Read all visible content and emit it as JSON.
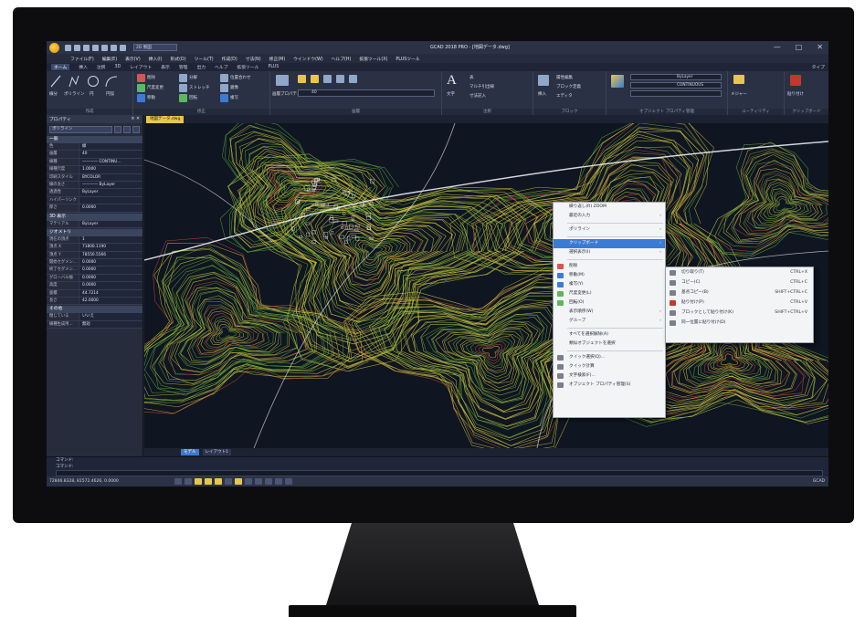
{
  "titlebar": {
    "workspace": "2D 製図",
    "document_title": "GCAD 2018 PRO - [地図データ.dwg]"
  },
  "menu": [
    "ファイル(F)",
    "編集(E)",
    "表示(V)",
    "挿入(I)",
    "形式(O)",
    "ツール(T)",
    "作成(D)",
    "寸法(N)",
    "修正(M)",
    "ウインドウ(W)",
    "ヘルプ(H)",
    "拡張ツール(X)",
    "PLUSツール"
  ],
  "ribbon_tabs": [
    "ホーム",
    "挿入",
    "注釈",
    "3D",
    "レイアウト",
    "表示",
    "管理",
    "出力",
    "ヘルプ",
    "拡張ツール",
    "PLUS"
  ],
  "ribbon_tab_right": "タイプ",
  "ribbon": {
    "draw": {
      "label": "作成",
      "items": [
        "線分",
        "ポリライン",
        "円",
        "円弧"
      ]
    },
    "modify": {
      "label": "修正",
      "items": [
        "削除",
        "分解",
        "位置合わせ",
        "尺度変更",
        "ストレッチ",
        "鏡像",
        "移動",
        "回転",
        "複写"
      ]
    },
    "layer": {
      "label": "画層",
      "items": [
        "画層プロパティ管理"
      ],
      "layer_value": "40"
    },
    "annotation": {
      "label": "注釈",
      "items": [
        "文字",
        "表",
        "マルチ引出線",
        "寸法記入"
      ]
    },
    "block": {
      "label": "ブロック",
      "items": [
        "挿入",
        "属性編集",
        "ブロック定義",
        "エディタ"
      ]
    },
    "properties": {
      "label": "オブジェクト プロパティ管理",
      "bylayer": "ByLayer",
      "linetype": "CONTINUOUS"
    },
    "utility": {
      "label": "ユーティリティ",
      "items": [
        "メジャー"
      ]
    },
    "clipboard": {
      "label": "クリップボード",
      "items": [
        "貼り付け"
      ]
    }
  },
  "palette": {
    "title": "プロパティ",
    "selection": "ポリライン",
    "sections": [
      {
        "name": "一般",
        "rows": [
          {
            "k": "色",
            "v": "緑"
          },
          {
            "k": "画層",
            "v": "40"
          },
          {
            "k": "線種",
            "v": "———— CONTINU..."
          },
          {
            "k": "線種尺度",
            "v": "1.0000"
          },
          {
            "k": "印刷スタイル",
            "v": "BYCOLOR"
          },
          {
            "k": "線の太さ",
            "v": "———— ByLayer"
          },
          {
            "k": "透過性",
            "v": "ByLayer"
          },
          {
            "k": "ハイパーリンク",
            "v": ""
          },
          {
            "k": "厚さ",
            "v": "0.0000"
          }
        ]
      },
      {
        "name": "3D 表示",
        "rows": [
          {
            "k": "マテリアル",
            "v": "ByLayer"
          }
        ]
      },
      {
        "name": "ジオメトリ",
        "rows": [
          {
            "k": "現在の頂点",
            "v": "1"
          },
          {
            "k": "頂点 X",
            "v": "71800.1190"
          },
          {
            "k": "頂点 Y",
            "v": "78550.5566"
          },
          {
            "k": "開始セグメン...",
            "v": "0.0000"
          },
          {
            "k": "終了セグメン...",
            "v": "0.0000"
          },
          {
            "k": "グローバル幅",
            "v": "0.0000"
          },
          {
            "k": "高度",
            "v": "0.0000"
          },
          {
            "k": "面積",
            "v": "44.7214"
          },
          {
            "k": "長さ",
            "v": "42.0000"
          }
        ]
      },
      {
        "name": "その他",
        "rows": [
          {
            "k": "閉じている",
            "v": "いいえ"
          },
          {
            "k": "線種生成用...",
            "v": "無効"
          }
        ]
      }
    ]
  },
  "doc_tab": "地図データ.dwg",
  "layout_tabs": [
    "モデル",
    "レイアウト1"
  ],
  "context_menu": [
    {
      "label": "繰り返し(R) ZOOM"
    },
    {
      "label": "最近の入力",
      "arrow": true
    },
    {
      "sep": true
    },
    {
      "label": "ポリライン",
      "arrow": true
    },
    {
      "sep": true
    },
    {
      "label": "クリップボード",
      "arrow": true,
      "highlight": true
    },
    {
      "label": "選択表示(I)",
      "arrow": true
    },
    {
      "sep": true
    },
    {
      "label": "削除",
      "icon": "#d9534f"
    },
    {
      "label": "移動(M)",
      "icon": "#3a7bd5"
    },
    {
      "label": "複写(Y)",
      "icon": "#3a7bd5"
    },
    {
      "label": "尺度変更(L)",
      "icon": "#5cb85c"
    },
    {
      "label": "回転(O)",
      "icon": "#5cb85c"
    },
    {
      "label": "表示順序(W)",
      "arrow": true
    },
    {
      "label": "グループ",
      "arrow": true
    },
    {
      "sep": true
    },
    {
      "label": "すべてを選択解除(A)"
    },
    {
      "label": "類似オブジェクトを選択"
    },
    {
      "sep": true
    },
    {
      "label": "クイック選択(Q)...",
      "icon": "#7a7f8a"
    },
    {
      "label": "クイック計算",
      "icon": "#7a7f8a"
    },
    {
      "label": "文字検索(F)...",
      "icon": "#7a7f8a"
    },
    {
      "label": "オブジェクト プロパティ管理(S)",
      "icon": "#7a7f8a"
    }
  ],
  "submenu": [
    {
      "label": "切り取り(T)",
      "shortcut": "CTRL+X",
      "icon": "#7a7f8a"
    },
    {
      "label": "コピー(C)",
      "shortcut": "CTRL+C",
      "icon": "#7a7f8a"
    },
    {
      "label": "基点コピー(B)",
      "shortcut": "SHIFT+CTRL+C",
      "icon": "#7a7f8a"
    },
    {
      "label": "貼り付け(P)",
      "shortcut": "CTRL+V",
      "icon": "#c0392b"
    },
    {
      "label": "ブロックとして貼り付け(K)",
      "shortcut": "SHIFT+CTRL+V",
      "icon": "#7a7f8a"
    },
    {
      "label": "同一位置に貼り付け(D)",
      "shortcut": "",
      "icon": "#7a7f8a"
    }
  ],
  "command_line": {
    "line1": "コマンド:",
    "line2": "コマンド:"
  },
  "status": {
    "coords": "72846.8328, 81572.4626, 0.0000",
    "brand": "GCAD"
  },
  "colors": {
    "accent": "#3a7bd5",
    "contour_yellow": "#c9c23a",
    "contour_green": "#5ea83a",
    "contour_red": "#c8463a",
    "road_white": "#e9ecef"
  }
}
